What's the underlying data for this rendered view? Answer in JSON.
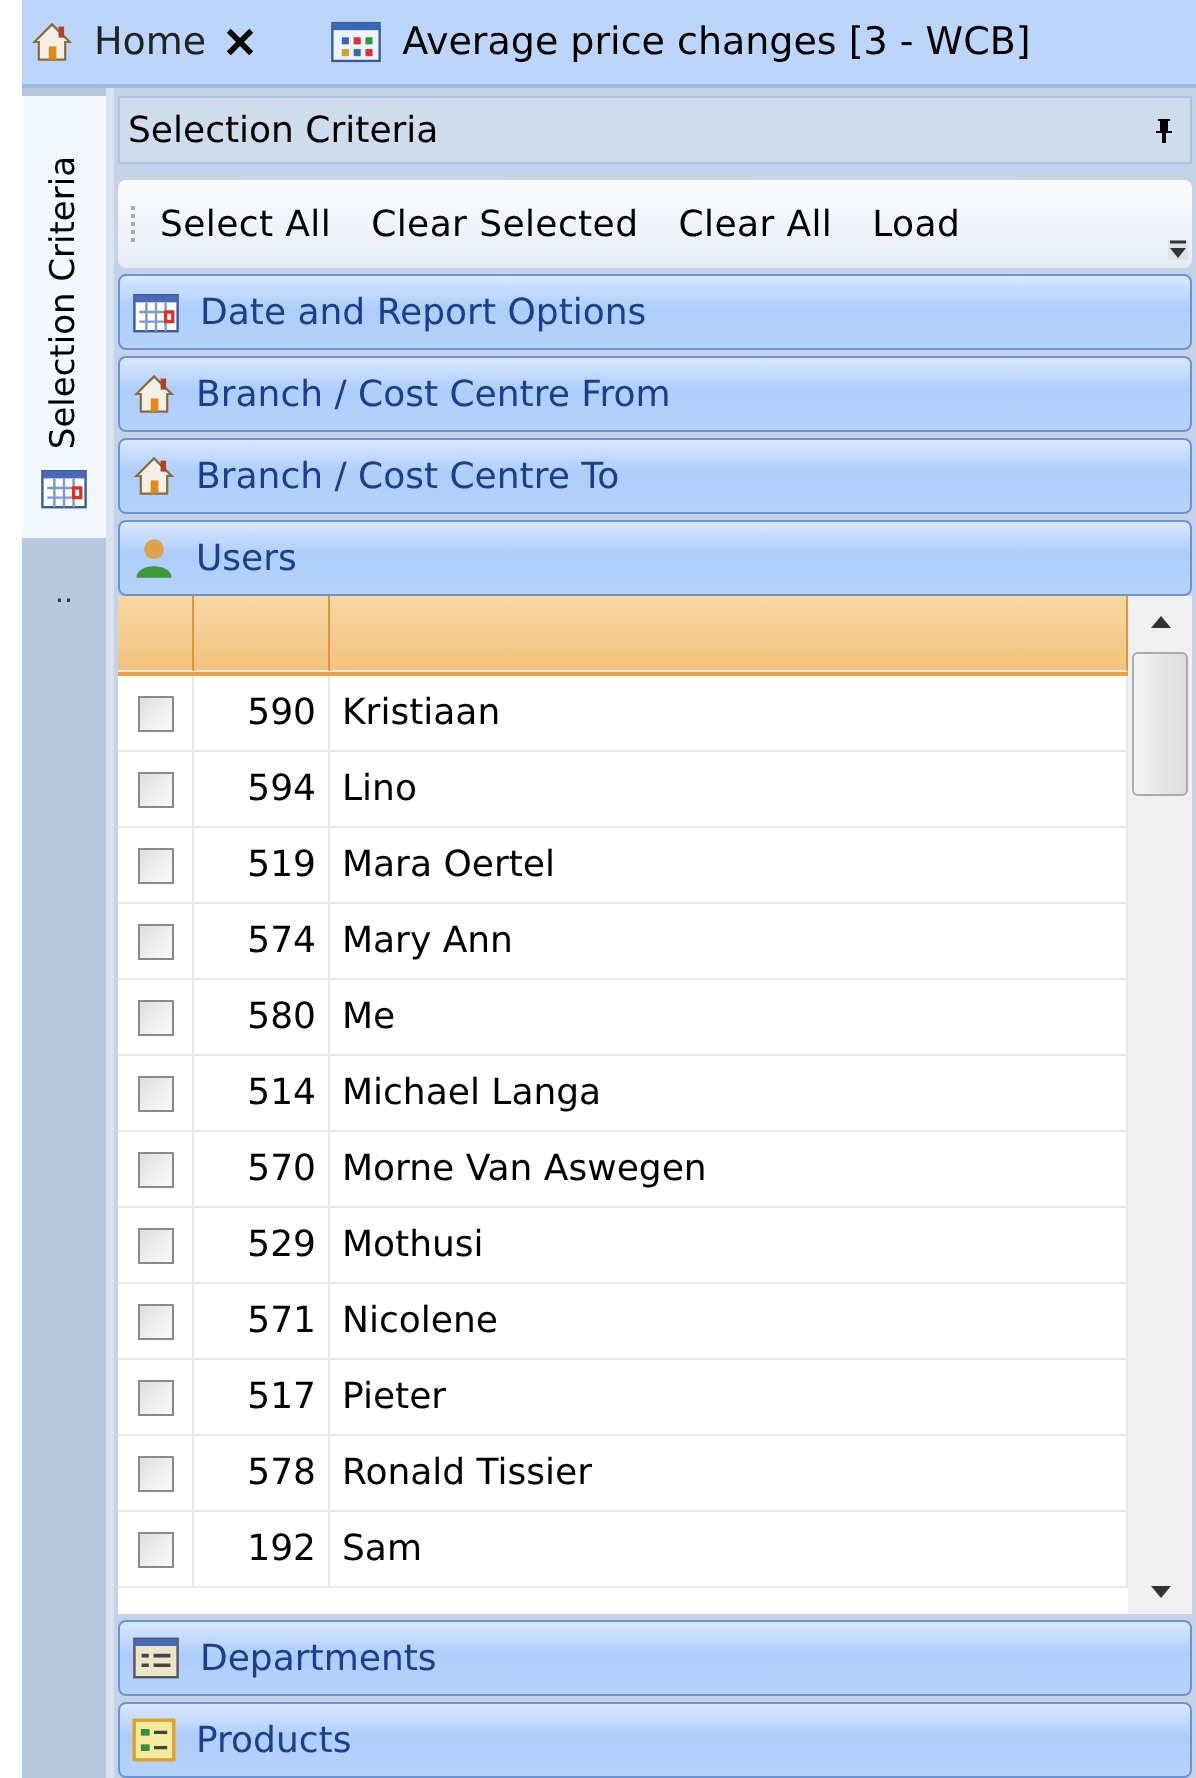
{
  "tabs": [
    {
      "label": "Home",
      "kind": "house",
      "closable": true,
      "selected": false
    },
    {
      "label": "Average price changes [3 - WCB]",
      "kind": "grid",
      "closable": false,
      "selected": true
    }
  ],
  "side_tab": {
    "label": "Selection Criteria"
  },
  "side_more": "..",
  "panel": {
    "title": "Selection Criteria",
    "pinned": true
  },
  "toolbar": [
    "Select All",
    "Clear Selected",
    "Clear All",
    "Load"
  ],
  "sections": [
    {
      "title": "Date and Report Options",
      "kind": "calendar",
      "expanded": false
    },
    {
      "title": "Branch / Cost Centre From",
      "kind": "house",
      "expanded": false
    },
    {
      "title": "Branch / Cost Centre To",
      "kind": "house",
      "expanded": false
    },
    {
      "title": "Users",
      "kind": "user",
      "expanded": true
    },
    {
      "title": "Departments",
      "kind": "list",
      "expanded": false
    },
    {
      "title": "Products",
      "kind": "tree",
      "expanded": false
    }
  ],
  "users": [
    {
      "code": "590",
      "name": "Kristiaan",
      "checked": false
    },
    {
      "code": "594",
      "name": "Lino",
      "checked": false
    },
    {
      "code": "519",
      "name": "Mara Oertel",
      "checked": false
    },
    {
      "code": "574",
      "name": "Mary Ann",
      "checked": false
    },
    {
      "code": "580",
      "name": "Me",
      "checked": false
    },
    {
      "code": "514",
      "name": "Michael Langa",
      "checked": false
    },
    {
      "code": "570",
      "name": "Morne Van Aswegen",
      "checked": false
    },
    {
      "code": "529",
      "name": "Mothusi",
      "checked": false
    },
    {
      "code": "571",
      "name": "Nicolene",
      "checked": false
    },
    {
      "code": "517",
      "name": "Pieter",
      "checked": false
    },
    {
      "code": "578",
      "name": "Ronald Tissier",
      "checked": false
    },
    {
      "code": "192",
      "name": "Sam",
      "checked": false
    }
  ]
}
